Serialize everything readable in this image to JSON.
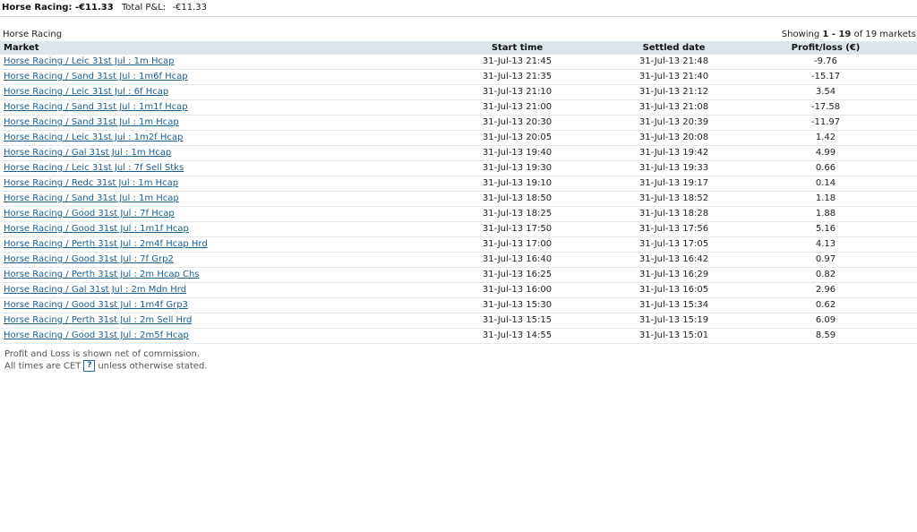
{
  "header": {
    "title": "Horse Racing: -€11.33",
    "pl_label": "Total P&L:",
    "pl_value": "-€11.33"
  },
  "section": {
    "title": "Horse Racing",
    "showing_prefix": "Showing ",
    "showing_range": "1 - 19",
    "showing_suffix": " of 19 markets"
  },
  "table": {
    "columns": [
      "Market",
      "Start time",
      "Settled date",
      "Profit/loss (€)"
    ],
    "rows": [
      {
        "market": "Horse Racing / Leic 31st Jul : 1m Hcap",
        "start": "31-Jul-13 21:45",
        "settled": "31-Jul-13 21:48",
        "pl": "-9.76"
      },
      {
        "market": "Horse Racing / Sand 31st Jul : 1m6f Hcap",
        "start": "31-Jul-13 21:35",
        "settled": "31-Jul-13 21:40",
        "pl": "-15.17"
      },
      {
        "market": "Horse Racing / Leic 31st Jul : 6f Hcap",
        "start": "31-Jul-13 21:10",
        "settled": "31-Jul-13 21:12",
        "pl": "3.54"
      },
      {
        "market": "Horse Racing / Sand 31st Jul : 1m1f Hcap",
        "start": "31-Jul-13 21:00",
        "settled": "31-Jul-13 21:08",
        "pl": "-17.58"
      },
      {
        "market": "Horse Racing / Sand 31st Jul : 1m Hcap",
        "start": "31-Jul-13 20:30",
        "settled": "31-Jul-13 20:39",
        "pl": "-11.97"
      },
      {
        "market": "Horse Racing / Leic 31st Jul : 1m2f Hcap",
        "start": "31-Jul-13 20:05",
        "settled": "31-Jul-13 20:08",
        "pl": "1.42"
      },
      {
        "market": "Horse Racing / Gal 31st Jul : 1m Hcap",
        "start": "31-Jul-13 19:40",
        "settled": "31-Jul-13 19:42",
        "pl": "4.99"
      },
      {
        "market": "Horse Racing / Leic 31st Jul : 7f Sell Stks",
        "start": "31-Jul-13 19:30",
        "settled": "31-Jul-13 19:33",
        "pl": "0.66"
      },
      {
        "market": "Horse Racing / Redc 31st Jul : 1m Hcap",
        "start": "31-Jul-13 19:10",
        "settled": "31-Jul-13 19:17",
        "pl": "0.14"
      },
      {
        "market": "Horse Racing / Sand 31st Jul : 1m Hcap",
        "start": "31-Jul-13 18:50",
        "settled": "31-Jul-13 18:52",
        "pl": "1.18"
      },
      {
        "market": "Horse Racing / Good 31st Jul : 7f Hcap",
        "start": "31-Jul-13 18:25",
        "settled": "31-Jul-13 18:28",
        "pl": "1.88"
      },
      {
        "market": "Horse Racing / Good 31st Jul : 1m1f Hcap",
        "start": "31-Jul-13 17:50",
        "settled": "31-Jul-13 17:56",
        "pl": "5.16"
      },
      {
        "market": "Horse Racing / Perth 31st Jul : 2m4f Hcap Hrd",
        "start": "31-Jul-13 17:00",
        "settled": "31-Jul-13 17:05",
        "pl": "4.13"
      },
      {
        "market": "Horse Racing / Good 31st Jul : 7f Grp2",
        "start": "31-Jul-13 16:40",
        "settled": "31-Jul-13 16:42",
        "pl": "0.97"
      },
      {
        "market": "Horse Racing / Perth 31st Jul : 2m Hcap Chs",
        "start": "31-Jul-13 16:25",
        "settled": "31-Jul-13 16:29",
        "pl": "0.82"
      },
      {
        "market": "Horse Racing / Gal 31st Jul : 2m Mdn Hrd",
        "start": "31-Jul-13 16:00",
        "settled": "31-Jul-13 16:05",
        "pl": "2.96"
      },
      {
        "market": "Horse Racing / Good 31st Jul : 1m4f Grp3",
        "start": "31-Jul-13 15:30",
        "settled": "31-Jul-13 15:34",
        "pl": "0.62"
      },
      {
        "market": "Horse Racing / Perth 31st Jul : 2m Sell Hrd",
        "start": "31-Jul-13 15:15",
        "settled": "31-Jul-13 15:19",
        "pl": "6.09"
      },
      {
        "market": "Horse Racing / Good 31st Jul : 2m5f Hcap",
        "start": "31-Jul-13 14:55",
        "settled": "31-Jul-13 15:01",
        "pl": "8.59"
      }
    ]
  },
  "footer": {
    "note1": "Profit and Loss is shown net of commission.",
    "note2_before": "All times are CET",
    "help_icon": "?",
    "help_icon_name": "help-icon",
    "note2_after": "unless otherwise stated."
  },
  "colors": {
    "link": "#1a5f8e",
    "header_bg": "#dde7eb",
    "row_border": "#e3e9ec"
  }
}
